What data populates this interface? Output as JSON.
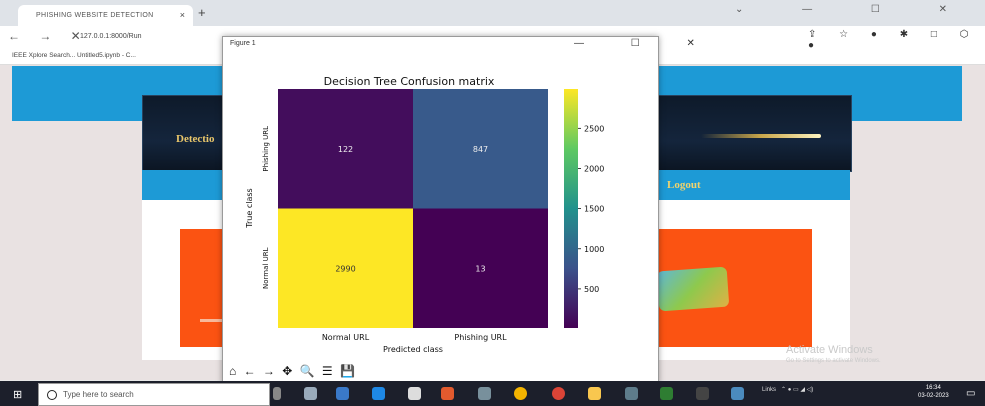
{
  "browser": {
    "tab_title": "PHISHING WEBSITE DETECTION",
    "tab_close": "×",
    "new_tab": "+",
    "nav": "← → ✕",
    "url": "127.0.0.1:8000/Run",
    "bookmarks": "IEEE Xplore Search...    Untitled5.ipynb - C...",
    "window_controls": "⌄ — ☐ ✕",
    "extensions": "⇪ ☆ ● ✱ □ ⬡ ●"
  },
  "page": {
    "detection_label": "Detectio",
    "logout_label": "Logout",
    "activate_title": "Activate Windows",
    "activate_sub": "Go to Settings to activate Windows."
  },
  "figure": {
    "window_title": "Figure 1",
    "controls": "— ☐ ✕",
    "toolbar": "⌂ ← → ✥ 🔍 ☰ 💾"
  },
  "chart_data": {
    "type": "heatmap",
    "title": "Decision Tree Confusion matrix",
    "xlabel": "Predicted class",
    "ylabel": "True class",
    "x_categories": [
      "Normal URL",
      "Phishing URL"
    ],
    "y_categories": [
      "Phishing URL",
      "Normal URL"
    ],
    "matrix": [
      [
        122,
        847
      ],
      [
        2990,
        13
      ]
    ],
    "colormap": "viridis",
    "colorbar_ticks": [
      500,
      1000,
      1500,
      2000,
      2500
    ],
    "colorbar_range": [
      13,
      2990
    ],
    "colors": {
      "low": "#440154",
      "mid_low": "#3b528b",
      "mid": "#21918c",
      "high": "#fde725"
    }
  },
  "taskbar": {
    "search_placeholder": "Type here to search",
    "tray_text": "Links",
    "time": "16:34",
    "date": "03-02-2023"
  }
}
